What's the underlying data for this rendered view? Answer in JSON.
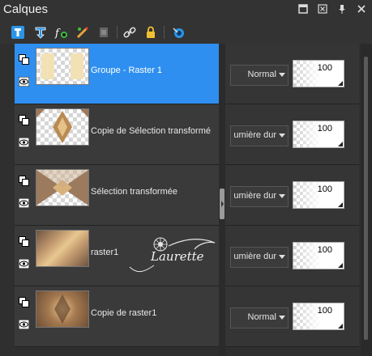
{
  "window": {
    "title": "Calques",
    "buttons": [
      "restore",
      "close",
      "pin",
      "close-panel"
    ]
  },
  "toolbar": {
    "tools": [
      "new-raster-layer-icon",
      "new-vector-layer-icon",
      "new-adjustment-layer-icon",
      "mask-icon",
      "delete-layer-icon",
      "link-icon",
      "lock-icon",
      "visibility-icon"
    ]
  },
  "layers": [
    {
      "name": "Groupe - Raster 1",
      "blend": "Normal",
      "opacity": "100",
      "selected": true
    },
    {
      "name": "Copie de Sélection transformé",
      "blend": "umière dur",
      "opacity": "100",
      "selected": false
    },
    {
      "name": "Sélection transformée",
      "blend": "umière dur",
      "opacity": "100",
      "selected": false
    },
    {
      "name": "raster1",
      "blend": "umière dur",
      "opacity": "100",
      "selected": false
    },
    {
      "name": "Copie de raster1",
      "blend": "Normal",
      "opacity": "100",
      "selected": false
    }
  ],
  "watermark": {
    "text": "Laurette"
  },
  "colors": {
    "selection": "#2e8ff0",
    "panel": "#2f2f2f"
  }
}
